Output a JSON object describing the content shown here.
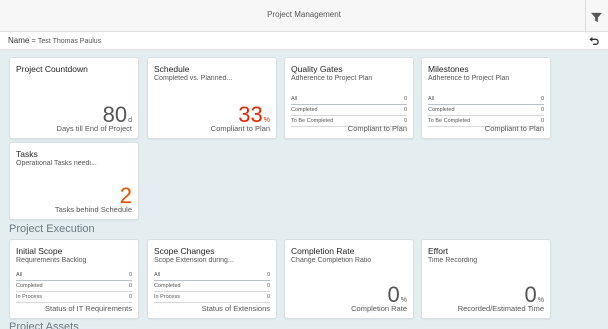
{
  "shell": {
    "title": "Project Management",
    "filter_icon": "filter-icon"
  },
  "subheader": {
    "name_label": "Name",
    "name_op": "=",
    "name_value": "Test Thomas Paulus",
    "undo_icon": "undo-icon"
  },
  "sections": {
    "execution_title": "Project Execution",
    "assets_title": "Project Assets"
  },
  "colors": {
    "kpi_red": "#e32700",
    "kpi_orange": "#e65100",
    "background": "#e4eef0"
  },
  "tiles": {
    "countdown": {
      "title": "Project Countdown",
      "subtitle": "",
      "value": "80",
      "unit": "d",
      "footer": "Days till End of Project"
    },
    "schedule": {
      "title": "Schedule",
      "subtitle": "Completed vs. Planned...",
      "value": "33",
      "unit": "%",
      "footer": "Compliant to Plan"
    },
    "quality": {
      "title": "Quality Gates",
      "subtitle": "Adherence to Project Plan",
      "footer": "Compliant to Plan",
      "rows": [
        {
          "label": "All",
          "value": "0"
        },
        {
          "label": "Completed",
          "value": "0"
        },
        {
          "label": "To Be Completed",
          "value": "0"
        }
      ]
    },
    "milestones": {
      "title": "Milestones",
      "subtitle": "Adherence to Project Plan",
      "footer": "Compliant to Plan",
      "rows": [
        {
          "label": "All",
          "value": "0"
        },
        {
          "label": "Completed",
          "value": "0"
        },
        {
          "label": "To Be Completed",
          "value": "0"
        }
      ]
    },
    "tasks": {
      "title": "Tasks",
      "subtitle": "Operational Tasks needi...",
      "value": "2",
      "footer": "Tasks behind Schedule"
    },
    "initial_scope": {
      "title": "Initial Scope",
      "subtitle": "Requirements Backlog",
      "footer": "Status of IT Requirements",
      "rows": [
        {
          "label": "All",
          "value": "0"
        },
        {
          "label": "Completed",
          "value": "0"
        },
        {
          "label": "In Process",
          "value": "0"
        }
      ]
    },
    "scope_changes": {
      "title": "Scope Changes",
      "subtitle": "Scope Extension during...",
      "footer": "Status of Extensions",
      "rows": [
        {
          "label": "All",
          "value": "0"
        },
        {
          "label": "Completed",
          "value": "0"
        },
        {
          "label": "In Process",
          "value": "0"
        }
      ]
    },
    "completion_rate": {
      "title": "Completion Rate",
      "subtitle": "Change Completion Ratio",
      "value": "0",
      "unit": "%",
      "footer": "Completion Rate"
    },
    "effort": {
      "title": "Effort",
      "subtitle": "Time Recording",
      "value": "0",
      "unit": "%",
      "footer": "Recorded/Estimated Time"
    }
  }
}
